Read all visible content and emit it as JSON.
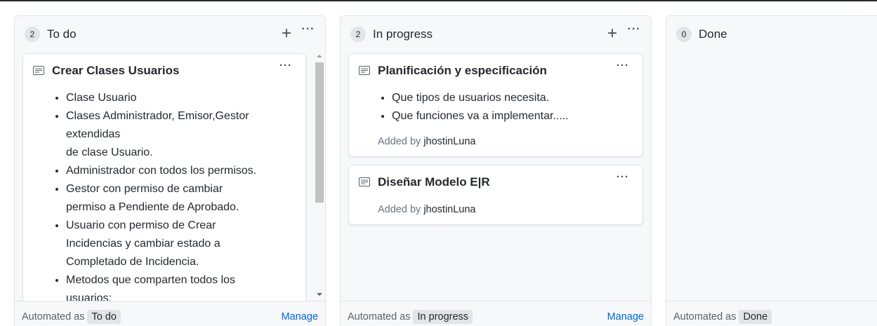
{
  "columns": [
    {
      "count": "2",
      "title": "To do",
      "cards": [
        {
          "title": "Crear Clases Usuarios",
          "bullets": [
            "Clase Usuario",
            "Clases Administrador, Emisor,Gestor extendidas",
            "de clase Usuario.",
            "Administrador con todos los permisos.",
            "Gestor con permiso de cambiar",
            "permiso a Pendiente de Aprobado.",
            "Usuario con permiso de Crear",
            "Incidencias y cambiar estado a",
            "Completado de Incidencia.",
            "Metodos que comparten todos los",
            "usuarios:"
          ]
        }
      ],
      "footer": {
        "automated_as": "Automated as",
        "automation": "To do",
        "manage": "Manage"
      }
    },
    {
      "count": "2",
      "title": "In progress",
      "cards": [
        {
          "title": "Planificación y especificación",
          "bullets": [
            "Que tipos de usuarios necesita.",
            "Que funciones va a implementar....."
          ],
          "added_by": "Added by",
          "user": "jhostinLuna"
        },
        {
          "title": "Diseñar Modelo E|R",
          "added_by": "Added by",
          "user": "jhostinLuna"
        }
      ],
      "footer": {
        "automated_as": "Automated as",
        "automation": "In progress",
        "manage": "Manage"
      }
    },
    {
      "count": "0",
      "title": "Done",
      "footer": {
        "automated_as": "Automated as",
        "automation": "Done"
      }
    }
  ],
  "icons": {
    "add": "plus-icon",
    "more": "kebab-horizontal-icon",
    "note": "note-icon"
  },
  "colors": {
    "column_bg": "#f6f8fa",
    "border": "#e1e4e8",
    "link": "#0366d6",
    "muted": "#6a737d"
  }
}
